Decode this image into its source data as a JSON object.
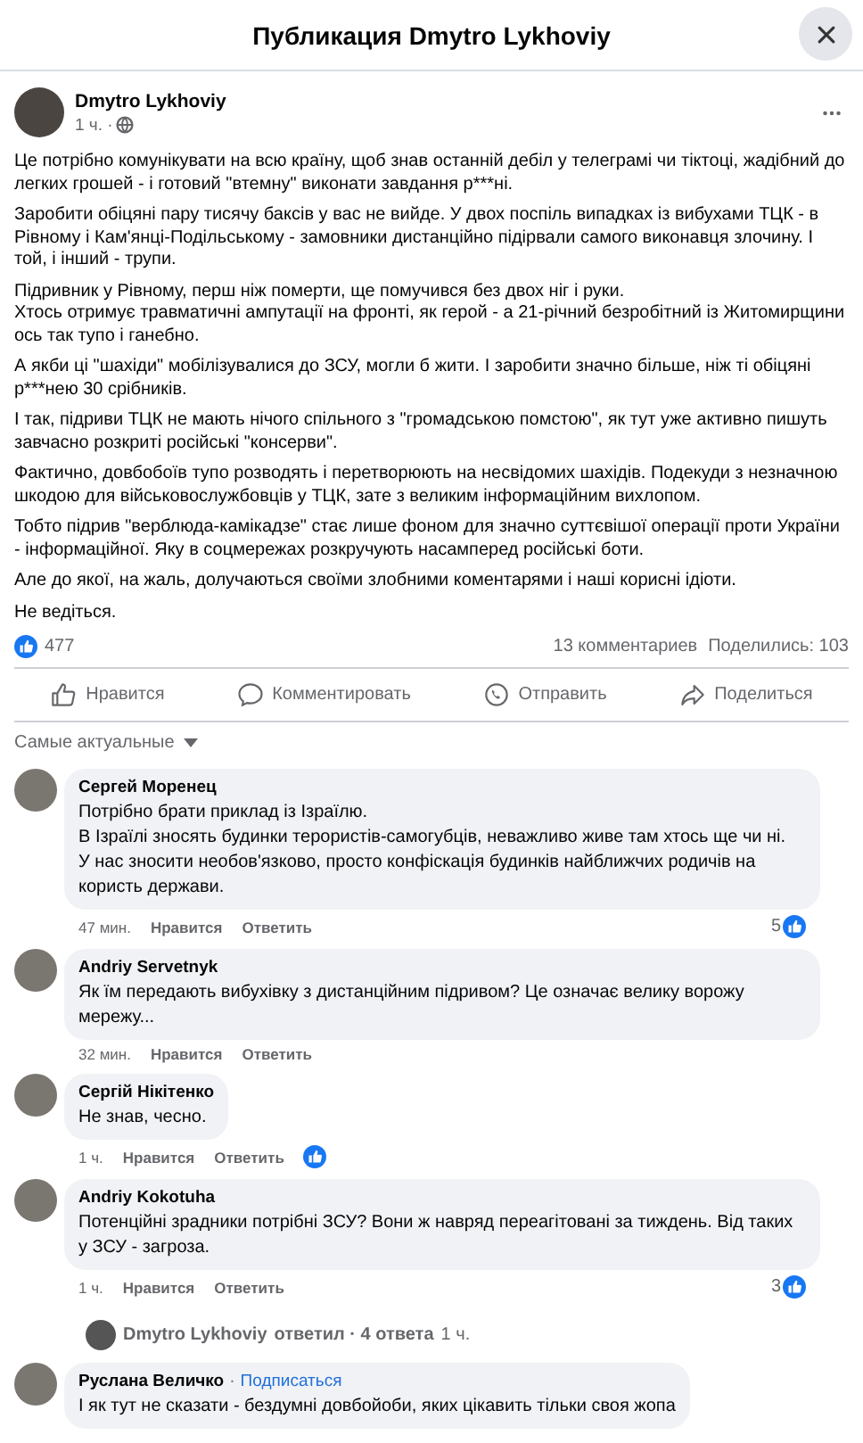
{
  "window": {
    "title": "Публикация Dmytro Lykhoviy"
  },
  "post": {
    "author": "Dmytro Lykhoviy",
    "time": "1 ч. ·",
    "paragraphs": [
      [
        "Це потрібно комунікувати на всю країну, щоб знав останній дебіл у телеграмі чи тіктоці, жадібний до легких грошей - і готовий \"втемну\" виконати завдання р***ні."
      ],
      [
        "Заробити обіцяні пару тисячу баксів у вас не вийде. У двох поспіль випадках із вибухами ТЦК - в Рівному і Кам'янці-Подільському - замовники дистанційно підірвали самого виконавця злочину. І той, і інший - трупи."
      ],
      [
        "Підривник у Рівному, перш ніж померти, ще помучився без двох ніг і руки.",
        "Хтось отримує травматичні ампутації на фронті, як герой - а 21-річний безробітний із Житомирщини ось так тупо і ганебно."
      ],
      [
        "А якби ці \"шахіди\" мобілізувалися до ЗСУ, могли б жити. І заробити значно більше, ніж ті обіцяні р***нею 30 срібників."
      ],
      [
        "І так, підриви ТЦК не мають нічого спільного з \"громадською помстою\", як тут уже активно пишуть завчасно розкриті російські \"консерви\"."
      ],
      [
        "Фактично, довбобоїв тупо розводять і перетворюють на несвідомих шахідів. Подекуди з незначною шкодою для військовослужбовців у ТЦК, зате з великим інформаційним вихлопом."
      ],
      [
        "Тобто підрив \"верблюда-камікадзе\" стає лише фоном для значно суттєвішої операції проти України - інформаційної. Яку в соцмережах розкручують насамперед російські боти."
      ],
      [
        "Але до якої, на жаль, долучаються своїми злобними коментарями і наші корисні ідіоти."
      ],
      [
        "Не ведіться."
      ]
    ],
    "likes": "477",
    "comments": "13 комментариев",
    "shares": "Поделились: 103"
  },
  "actions": [
    {
      "kind": "like",
      "label": "Нравится"
    },
    {
      "kind": "comment",
      "label": "Комментировать"
    },
    {
      "kind": "send",
      "label": "Отправить"
    },
    {
      "kind": "share",
      "label": "Поделиться"
    }
  ],
  "sort": "Самые актуальные",
  "comments": [
    {
      "kind": "comment",
      "author": "Сергей Моренец",
      "lines": [
        "Потрібно брати приклад із Ізраїлю.",
        "В Ізраїлі зносять будинки терористів-самогубців, неважливо живе там хтось ще чи ні.",
        "У нас зносити необов'язково, просто конфіскація будинків найближчих родичів на користь держави."
      ],
      "time": "47 мин.",
      "like": "Нравится",
      "reply": "Ответить",
      "reacted": true,
      "reaction_count": "5"
    },
    {
      "kind": "comment",
      "author": "Andriy Servetnyk",
      "lines": [
        "Як їм передають вибухівку з дистанційним підривом? Це означає велику ворожу мережу..."
      ],
      "time": "32 мин.",
      "like": "Нравится",
      "reply": "Ответить",
      "reacted": false
    },
    {
      "kind": "comment",
      "author": "Сергій Нікітенко",
      "lines": [
        "Не знав, чесно."
      ],
      "time": "1 ч.",
      "like": "Нравится",
      "reply": "Ответить",
      "reacted": true
    },
    {
      "kind": "comment",
      "author": "Andriy Kokotuha",
      "lines": [
        "Потенційні зрадники потрібні ЗСУ? Вони ж навряд переагітовані за тиждень. Від таких у ЗСУ - загроза."
      ],
      "time": "1 ч.",
      "like": "Нравится",
      "reply": "Ответить",
      "reacted": true,
      "reaction_count": "3"
    },
    {
      "kind": "replies",
      "author": "Dmytro Lykhoviy",
      "text": "ответил · 4 ответа",
      "time": "1 ч."
    },
    {
      "kind": "comment",
      "author": "Руслана Величко",
      "separator": "·",
      "follow": "Подписаться",
      "lines": [
        "І як тут не сказати - бездумні довбойоби, яких цікавить тільки своя жопа"
      ]
    }
  ]
}
